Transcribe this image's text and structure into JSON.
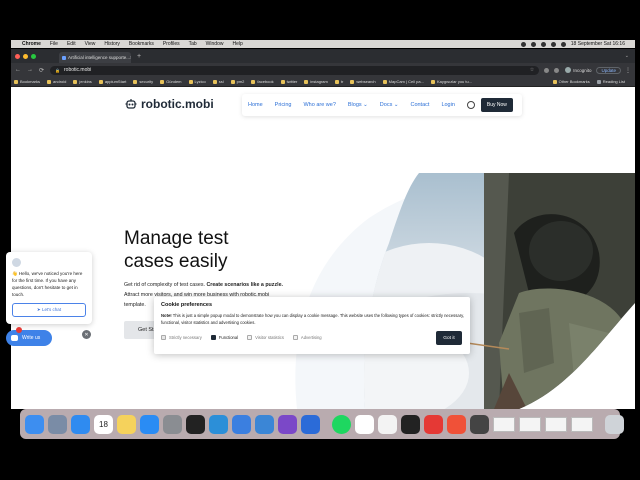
{
  "menubar": {
    "items": [
      "Chrome",
      "File",
      "Edit",
      "View",
      "History",
      "Bookmarks",
      "Profiles",
      "Tab",
      "Window",
      "Help"
    ],
    "datetime": "18 September Sat  16:16"
  },
  "browser": {
    "tab_title": "Artificial intelligence supporte...",
    "url": "robotic.mobi",
    "profile_label": "Incognito",
    "update_label": "Update",
    "bookmarks": [
      "Bookmarks",
      "android",
      "jenkins",
      "appiumStart",
      "security",
      "Gündem",
      "Lyzico",
      "ssl",
      "pm2",
      "facebook",
      "twitter",
      "instagram",
      "tr",
      "websearch",
      "MapCam | Cell pa...",
      "Kaygısızlar you tu..."
    ],
    "other_bookmarks": "Other Bookmarks",
    "reading_list": "Reading List"
  },
  "site": {
    "logo": "robotic.mobi",
    "nav": {
      "home": "Home",
      "pricing": "Pricing",
      "who": "Who are we?",
      "blogs": "Blogs ⌄",
      "docs": "Docs ⌄",
      "contact": "Contact",
      "login": "Login",
      "buy": "Buy Now"
    },
    "hero": {
      "title_line1": "Manage test",
      "title_line2": "cases easily",
      "sub_plain": "Get rid of complexity of test cases. ",
      "sub_bold": "Create scenarios like a puzzle.",
      "sub2": "Attract more visitors, and win more business with robotic.mobi template.",
      "cta": "Get Started"
    }
  },
  "chat": {
    "message": "👋 Hello, we've noticed you're here for the first time. If you have any questions, don't hesitate to get in touch.",
    "button": "➤ Let's chat",
    "launcher": "Write us",
    "close": "✕"
  },
  "cookie": {
    "title": "Cookie preferences",
    "note_label": "Note!",
    "note_text": " This is just a simple popup modal to demonstrate how you can display a cookie message. This website uses the following types of cookies: strictly necessary, functional, visitor statistics and advertising cookies.",
    "options": [
      "Strictly necessary",
      "Functional",
      "Visitor statistics",
      "Advertising"
    ],
    "accept": "Got it"
  },
  "dock": {
    "apps": [
      "finder-icon",
      "launchpad-icon",
      "safari-icon",
      "calendar-icon",
      "notes-icon",
      "appstore-icon",
      "system-preferences-icon",
      "intellij-icon",
      "vscode-icon",
      "xcode-icon",
      "android-studio-icon",
      "visual-studio-icon",
      "proxy-icon",
      "spotify-icon",
      "chrome-icon",
      "slack-icon",
      "terminal-icon",
      "anydesk-icon",
      "swift-icon",
      "git-icon",
      "trash-icon"
    ],
    "calendar_day": "18"
  },
  "colors": {
    "brand_dark": "#1f2a37",
    "link_blue": "#2b6fd6",
    "chat_blue": "#3e82e8",
    "play_green": "#2ca55a"
  }
}
